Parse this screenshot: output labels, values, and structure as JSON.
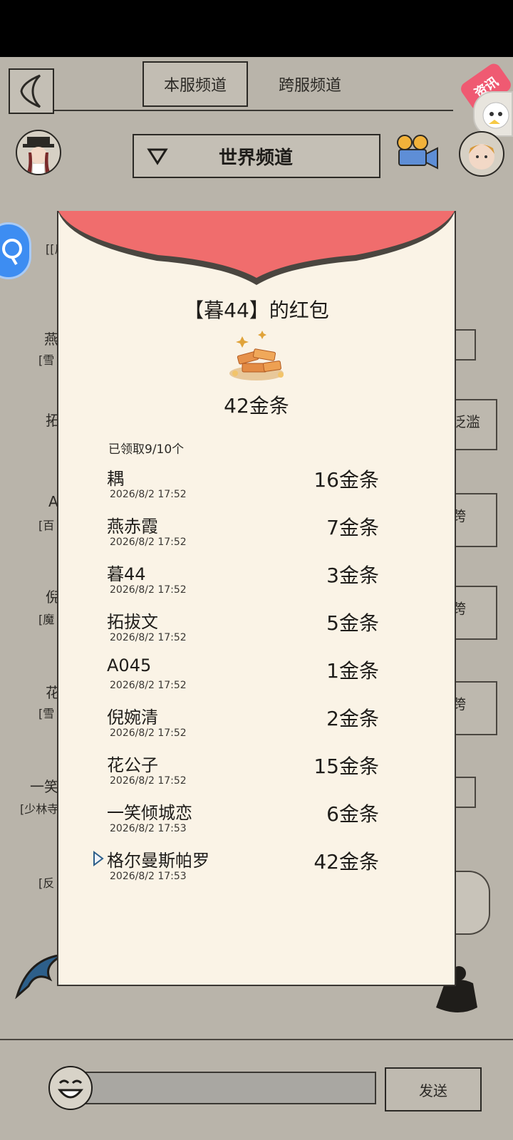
{
  "tabs": [
    {
      "label": "本服频道",
      "active": true
    },
    {
      "label": "跨服频道",
      "active": false
    }
  ],
  "channel": {
    "label": "世界频道"
  },
  "news_badge": "资讯",
  "send_label": "发送",
  "icons": {
    "back": "back-arrow-icon",
    "dropdown": "triangle-down-icon",
    "camera": "movie-camera-icon",
    "search": "search-icon",
    "emoji": "emoji-icon",
    "gold": "gold-bars-icon"
  },
  "colors": {
    "accent_red": "#f06d6d",
    "modal_bg": "#faf3e6",
    "page_bg": "#b9b4aa",
    "badge_pink": "#ef5a72",
    "fab_blue": "#3d8df2"
  },
  "background_fragments": {
    "left": [
      "燕",
      "[雪",
      "拓",
      "A",
      "[百",
      "倪",
      "[魔",
      "花",
      "[雪",
      "一笑",
      "[少林寺",
      "[反",
      "[反"
    ],
    "right": [
      "泛滥",
      "跨",
      "跨",
      "跨"
    ]
  },
  "red_packet": {
    "title": "【暮44】的红包",
    "total": "42金条",
    "claimed": "已领取9/10个",
    "entries": [
      {
        "name": "耦",
        "time": "2026/8/2 17:52",
        "amount": "16金条",
        "self": false
      },
      {
        "name": "燕赤霞",
        "time": "2026/8/2 17:52",
        "amount": "7金条",
        "self": false
      },
      {
        "name": "暮44",
        "time": "2026/8/2 17:52",
        "amount": "3金条",
        "self": false
      },
      {
        "name": "拓拔文",
        "time": "2026/8/2 17:52",
        "amount": "5金条",
        "self": false
      },
      {
        "name": "A045",
        "time": "2026/8/2 17:52",
        "amount": "1金条",
        "self": false
      },
      {
        "name": "倪婉清",
        "time": "2026/8/2 17:52",
        "amount": "2金条",
        "self": false
      },
      {
        "name": "花公子",
        "time": "2026/8/2 17:52",
        "amount": "15金条",
        "self": false
      },
      {
        "name": "一笑倾城恋",
        "time": "2026/8/2 17:53",
        "amount": "6金条",
        "self": false
      },
      {
        "name": "格尔曼斯帕罗",
        "time": "2026/8/2 17:53",
        "amount": "42金条",
        "self": true
      }
    ]
  }
}
